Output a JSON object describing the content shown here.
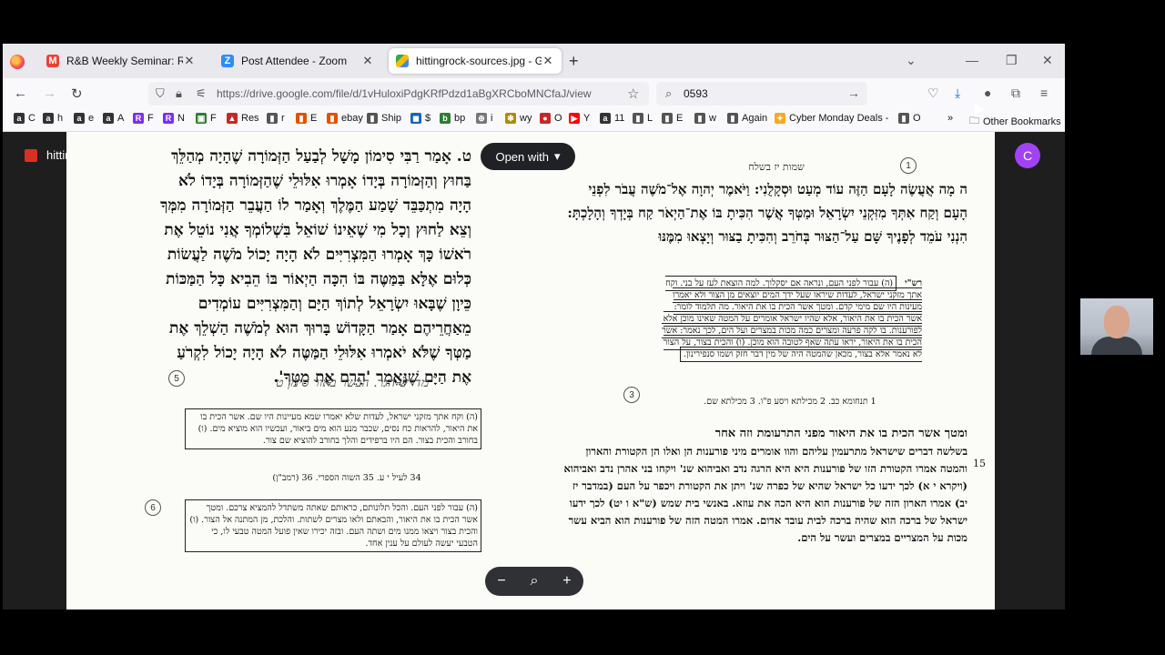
{
  "browser": {
    "tabs": [
      {
        "title": "R&B Weekly Seminar: R&B Tora",
        "favicon": "gmail-icon",
        "color": "#ea4335"
      },
      {
        "title": "Post Attendee - Zoom",
        "favicon": "zoom-icon",
        "color": "#2d8cff"
      },
      {
        "title": "hittingrock-sources.jpg - Goog",
        "favicon": "drive-icon",
        "color": "#fbbc04"
      }
    ],
    "url": "https://drive.google.com/file/d/1vHuloxiPdgKRfPdzd1aBgXRCboMNCfaJ/view",
    "search_value": "0593",
    "bookmarks": [
      "C",
      "h",
      "e",
      "A",
      "F",
      "N",
      "F",
      "Res",
      "r",
      "E",
      "ebay",
      "Ship",
      "$",
      "bp",
      "i",
      "wy",
      "O",
      "Y",
      "11",
      "L",
      "E",
      "w",
      "Again",
      "Cyber Monday Deals -",
      "O"
    ],
    "other_bookmarks": "Other Bookmarks"
  },
  "viewer": {
    "file_title": "hittingrock-sources.jpg",
    "open_with": "Open with",
    "avatar_letter": "C",
    "zoom_minus": "−",
    "zoom_plus": "+"
  },
  "document": {
    "left_main": "ט. אָמַר רַבִּי סִימוֹן מָשָׁל לְבַעַל הַזְּמוֹרָה שֶׁהָיָה מְהַלֵּךְ בַּחוּץ וְהַזְּמוֹרָה בְּיָדוֹ אָמְרוּ אִלּוּלֵי שֶׁהַזְּמוֹרָה בְּיָדוֹ לֹא הָיָה מִתְכַּבֵּד שָׁמַע הַמֶּלֶךְ וְאָמַר לוֹ הַעֲבֵר הַזְּמוֹרָה מִמְּךָ וְצֵא לַחוּץ וְכָל מִי שֶׁאֵינוֹ שׁוֹאֵל בִּשְׁלוֹמְךָ אֲנִי נוֹטֵל אֶת רֹאשׁוֹ כָּךְ אָמְרוּ הַמִּצְרִיִּים לֹא הָיָה יָכוֹל מֹשֶׁה לַעֲשׂוֹת כְּלוּם אֶלָּא בַּמַּטֶּה בּוֹ הִכָּה הַיְאוֹר בּוֹ הֵבִיא כָּל הַמַּכּוֹת כֵּיוָן שֶׁבָּאוּ יִשְׂרָאֵל לְתוֹךְ הַיָּם וְהַמִּצְרִיִּים עוֹמְדִים מֵאַחֲרֵיהֶם אָמַר הַקָּדוֹשׁ בָּרוּךְ הוּא לְמֹשֶׁה הַשְׁלֵךְ אֶת מַטְּךָ שֶׁלֹּא יֹאמְרוּ אִלּוּלֵי הַמַּטֶּה לֹא הָיָה יָכוֹל לִקְרֹעַ אֶת הַיָּם שֶׁנֶּאֱמַר 'הָרֵם אֶת מַטְּךָ'.",
    "left_hand_title": "מדרש הגר. הבשר באור סימן ט",
    "left_small_1": "(ה) וקח אתך מזקני ישראל, לעדות שלא יאמרו שמא מעיינות היו שם. אשר הכית בו את היאור, להראות כח נסים, שכבר מנע הוא מים ביאור, ועכשיו הוא מוציא מים. (ו) בחורב והכית בצור. הם היו ברפידים והלך בחורב להוציא שם צור.",
    "left_small_2": "(ה) עבור לפני העם. והכל תלונותם, כראותם שאתה משתדל להמציא צרכם. ומטך אשר הכית בו את היאור, והבאתם ולאו מצרים לשתות. והלכת, מן המתנה אל הצור. (ו) והכית בצור ויצאו ממנו מים ושתה העם. ובזה יכירו שאין פועל המטה טבעי לו, כי הטבעי יעשה לעולם על ענין אחד.",
    "right_header": "שמות יז בשלח",
    "right_verse": "ה מָה אֲעֲשֶׂה לָעָם הַזֶּה עוֹד מְעַט וּסְקָלֻנִי: וַיֹּאמֶר יְהוָה אֶל־מֹשֶׁה עֲבֹר לִפְנֵי הָעָם וְקַח אִתְּךָ מִזִּקְנֵי יִשְׂרָאֵל וּמַטְּךָ אֲשֶׁר הִכִּיתָ בּוֹ אֶת־הַיְאֹר קַח בְּיָדְךָ וְהָלָכְתָּ: הִנְנִי עֹמֵד לְפָנֶיךָ שָּׁם עַל־הַצּוּר בְּחֹרֵב וְהִכִּיתָ בַצּוּר וְיָצְאוּ מִמֶּנּוּ",
    "right_rashi_label": "רש\"י",
    "right_rashi": "(ה) עבור לפני העם, ונראה אם יסקלוך. למה הוצאת לעז על בני. וקח אתך מזקני ישראל, לעדות שיראו שעל ידך המים יוצאים מן הצור ולא יאמרו מעינות היו שם מימי קדם. ומטך אשר הכית בו את היאור. מה תלמוד לומר: אשר הכית בו את היאור, אלא שהיו ישראל אומרים על המטה שאינו מוכן אלא לפורענות. בו לקה פרעה ומצרים כמה מכות במצרים ועל הים, לכך נאמר: אשר הכית בו את היאור, יראו עתה שאף לטובה הוא מוכן. (ו) והכית בצור, על הצור לא נאמר אלא בצור, מכאן שהמטה היה של מין דבר חזק ושמו סנפירינון.",
    "right_lower_title": "ומטך אשר הכית בו את היאור מפני התרעומת וזה אחר",
    "right_lower": "בשלשה דברים שישראל מתרעמין עליהם והוו אומרים מיני פורענות הן ואלו הן הקטורת והארון והמטה אמרו הקטורת הזו של פורענות היא היא הרגה נדב ואביהוא שנ' ויקחו בני אהרן נדב ואביהוא (ויקרא י א) לכך ידעו כל ישראל שהיא של כפרה שנ' ויתן את הקטורת ויכפר על העם (במדבר יז יב) אמרו הארון הזה של פורענות הוא היא הכה את עוזא. באנשי בית שמש (ש\"א ו יט) לכך ידעו ישראל של ברכה הוא שהיה ברכה לבית עובד אדום. אמרו המטה הזה של פורענות הוא הביא עשר מכות על המצריים במצרים ועשר על הים.",
    "right_lower_number": "15",
    "right_foot_note": "1 תנחומא כב. 2 מכילתא ויסע פ\"ו. 3 מכילתא שם.",
    "left_foot_note": "34 לעיל י ע. 35 השוה הספרי. 36 (רמב\"ן)",
    "circle_labels": [
      "5",
      "6",
      "3",
      "1"
    ]
  }
}
